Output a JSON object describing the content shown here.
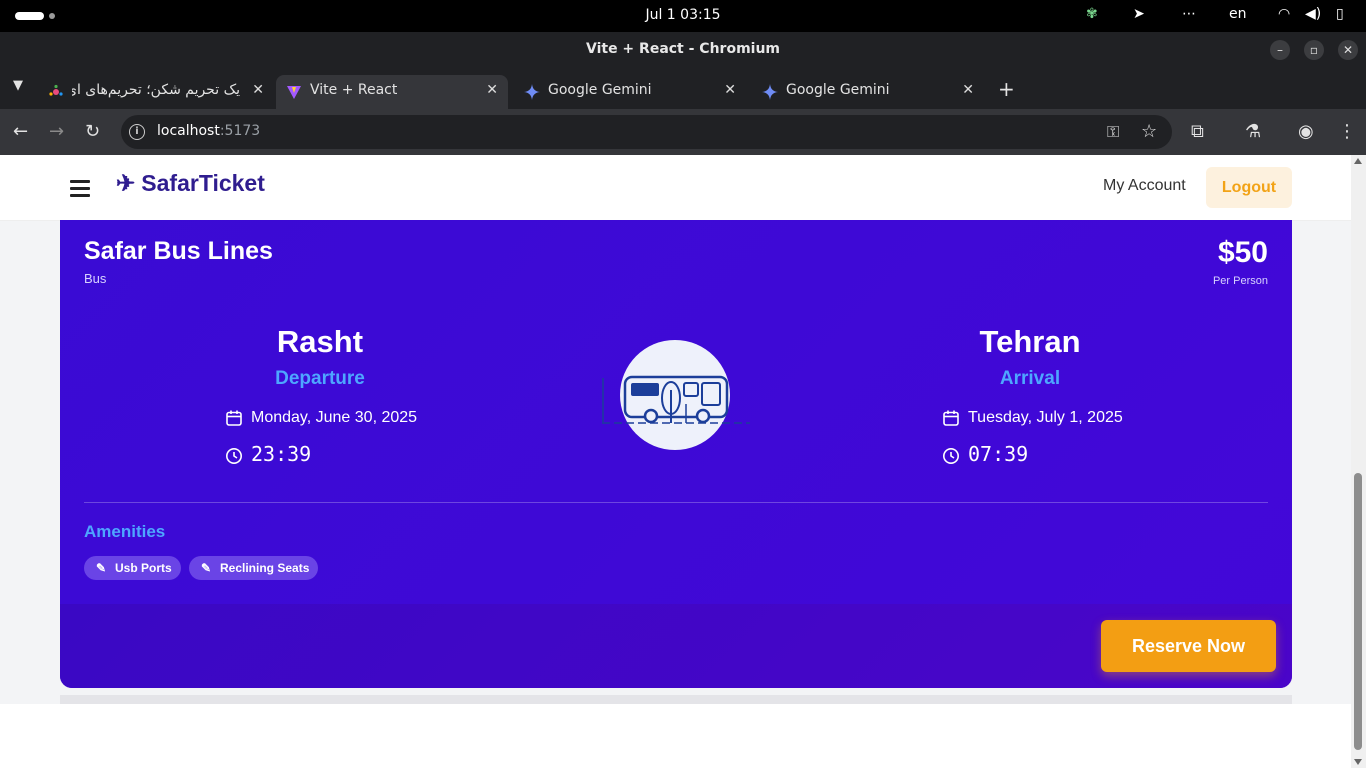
{
  "system": {
    "clock": "Jul 1  03:15",
    "lang": "en"
  },
  "window": {
    "title": "Vite + React - Chromium"
  },
  "tabs": [
    {
      "label": "یک تحریم شکن؛ تحریم‌های ای",
      "active": false
    },
    {
      "label": "Vite + React",
      "active": true
    },
    {
      "label": "Google Gemini",
      "active": false
    },
    {
      "label": "Google Gemini",
      "active": false
    }
  ],
  "omnibox": {
    "host": "localhost",
    "port": ":5173"
  },
  "app": {
    "brand": "SafarTicket",
    "nav": {
      "my_account": "My Account",
      "logout": "Logout"
    }
  },
  "ticket": {
    "company": "Safar Bus Lines",
    "type": "Bus",
    "price": "$50",
    "price_note": "Per Person",
    "departure": {
      "city": "Rasht",
      "label": "Departure",
      "date": "Monday, June 30, 2025",
      "time": "23:39"
    },
    "arrival": {
      "city": "Tehran",
      "label": "Arrival",
      "date": "Tuesday, July 1, 2025",
      "time": "07:39"
    },
    "amenities_title": "Amenities",
    "amenities": [
      "Usb Ports",
      "Reclining Seats"
    ],
    "reserve_label": "Reserve Now"
  },
  "colors": {
    "card": "#3f0ad6",
    "accent_blue": "#4ea6ff",
    "reserve": "#f39e13",
    "brand": "#2f1d8f"
  }
}
